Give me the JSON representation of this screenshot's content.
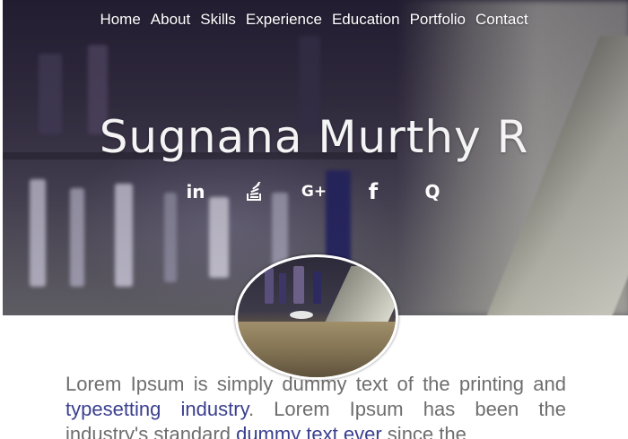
{
  "nav": {
    "items": [
      "Home",
      "About",
      "Skills",
      "Experience",
      "Education",
      "Portfolio",
      "Contact"
    ]
  },
  "hero": {
    "name": "Sugnana Murthy R"
  },
  "social": [
    {
      "icon": "linkedin-icon",
      "glyph": "in"
    },
    {
      "icon": "stackoverflow-icon",
      "glyph": "≋"
    },
    {
      "icon": "google-plus-icon",
      "glyph": "G+"
    },
    {
      "icon": "facebook-icon",
      "glyph": "f"
    },
    {
      "icon": "quora-icon",
      "glyph": "Q"
    }
  ],
  "bio": {
    "part1": "Lorem Ipsum is simply dummy text of the printing and ",
    "link1": "typesetting industry",
    "part2": ". Lorem Ipsum has been the industry's standard ",
    "link2": "dummy text ever",
    "part3": " since the"
  },
  "colors": {
    "link": "#3a3f8f",
    "body_text": "#6e6e6e"
  }
}
